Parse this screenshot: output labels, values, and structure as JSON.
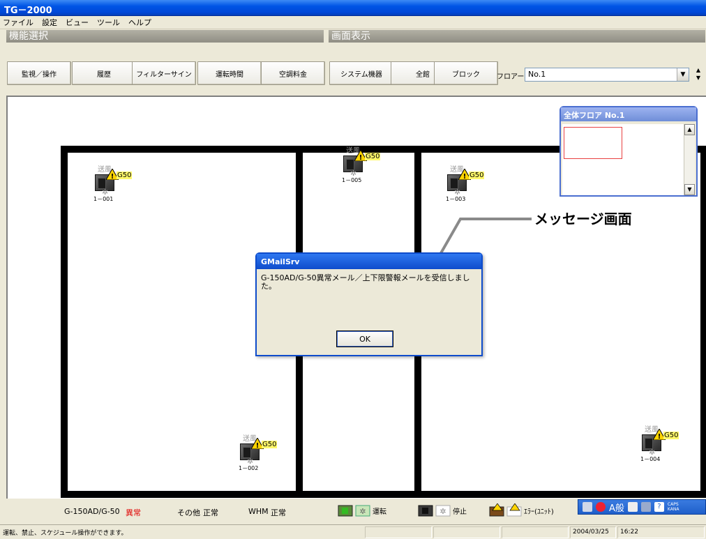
{
  "window": {
    "title": "TG－2000"
  },
  "menu": [
    "ファイル",
    "設定",
    "ビュー",
    "ツール",
    "ヘルプ"
  ],
  "groups": {
    "function_select": "機能選択",
    "screen_display": "画面表示"
  },
  "toolbar": {
    "left": [
      "監視／操作",
      "履歴",
      "フィルターサイン",
      "運転時間",
      "空調料金"
    ],
    "right": [
      "システム機器",
      "全館",
      "ブロック"
    ],
    "floor_label": "フロアー",
    "floor_value": "No.1"
  },
  "units": [
    {
      "mode": "送風",
      "tag": "G50",
      "id": "1－001"
    },
    {
      "mode": "送風",
      "tag": "G50",
      "id": "1－005"
    },
    {
      "mode": "送風",
      "tag": "G50",
      "id": "1－003"
    },
    {
      "mode": "送風",
      "tag": "G50",
      "id": "1－002"
    },
    {
      "mode": "送風",
      "tag": "G50",
      "id": "1－004"
    }
  ],
  "overview": {
    "title": "全体フロア No.1"
  },
  "callout": "メッセージ画面",
  "dialog": {
    "title": "GMailSrv",
    "message": "G-150AD/G-50異常メール／上下限警報メールを受信しました。",
    "ok": "OK"
  },
  "status": {
    "g50_label": "G-150AD/G-50",
    "g50_state": "異常",
    "other_label": "その他",
    "other_state": "正常",
    "whm_label": "WHM",
    "whm_state": "正常",
    "legend_run": "運転",
    "legend_stop": "停止",
    "legend_error": "ｴﾗｰ(ﾕﾆｯﾄ)"
  },
  "ime": {
    "text": "A般",
    "caps": "CAPS",
    "kana": "KANA"
  },
  "statusbar": {
    "message": "運転、禁止、スケジュール操作ができます。",
    "date": "2004/03/25",
    "time": "16:22"
  },
  "colors": {
    "title_blue": "#0055e5",
    "alarm_red": "#e00000",
    "tag_yellow": "#fff86a"
  }
}
